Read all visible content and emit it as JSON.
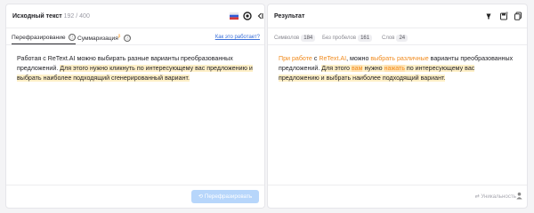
{
  "left_panel": {
    "title": "Исходный текст",
    "char_count": "192 / 400",
    "tabs": {
      "rephrase": "Перефразирование",
      "summarize": "Суммаризация",
      "summarize_badge": "β"
    },
    "info_icon": "ⓘ",
    "how_link": "Как это работает?",
    "text": {
      "s1_plain": "Работая с ReText.AI можно выбирать разные варианты преобразованных предложений. ",
      "s2_highlight": "Для этого нужно кликнуть по интересующему вас предложению и выбрать наиболее подходящий сгенерированный вариант."
    },
    "button_label": "⟲ Перефразировать",
    "icons": [
      "russian-flag-icon",
      "settings-icon",
      "collapse-icon"
    ]
  },
  "right_panel": {
    "title": "Результат",
    "stats": {
      "chars_label": "Символов",
      "chars_value": "184",
      "nospace_label": "Без пробелов",
      "nospace_value": "161",
      "words_label": "Слов",
      "words_value": "24"
    },
    "text": {
      "p1": "При работе",
      "p2": " с ",
      "p3": "ReText.AI",
      "p4": ", можно ",
      "p5": "выбрать различные",
      "p6": " варианты преобразованных предложений. ",
      "p7": "Для этого ",
      "p8": "вам",
      "p9": " нужно ",
      "p10": "нажать",
      "p11": " по интересующему вас предложению и выбрать наиболее подходящий вариант."
    },
    "uniqueness_label": "⇄ Уникальность",
    "icons": [
      "download-icon",
      "save-icon",
      "copy-icon"
    ]
  },
  "colors": {
    "accent": "#3a6fd8",
    "change": "#f08a1c",
    "highlight": "#fff0c8",
    "button": "#b7d6fb"
  }
}
